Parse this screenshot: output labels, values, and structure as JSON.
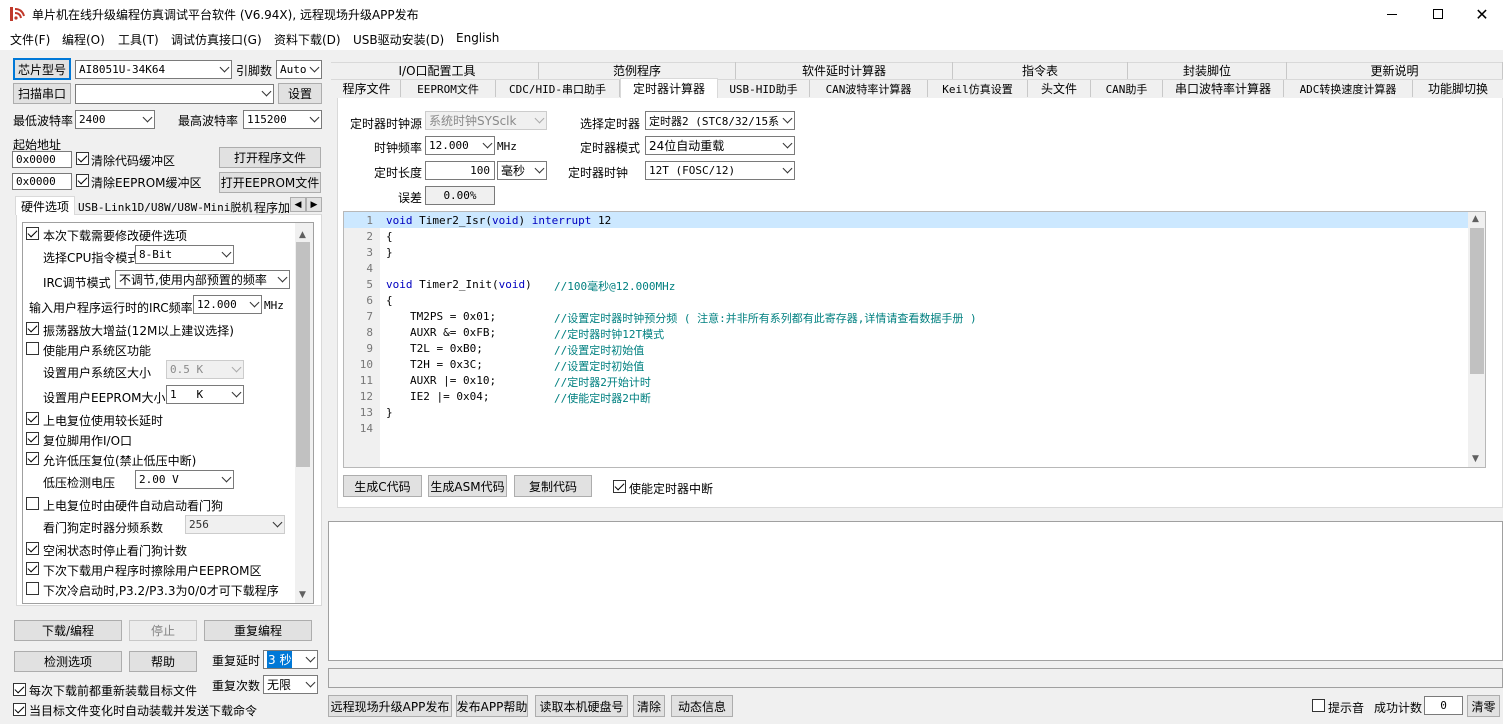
{
  "window": {
    "title": "单片机在线升级编程仿真调试平台软件 (V6.94X), 远程现场升级APP发布"
  },
  "menu": [
    "文件(F)",
    "编程(O)",
    "工具(T)",
    "调试仿真接口(G)",
    "资料下载(D)",
    "USB驱动安装(D)",
    "English"
  ],
  "left": {
    "chip_btn": "芯片型号",
    "chip_value": "AI8051U-34K64",
    "pin_label": "引脚数",
    "pin_value": "Auto",
    "scan_btn": "扫描串口",
    "port_value": "",
    "settings_btn": "设置",
    "min_baud_label": "最低波特率",
    "min_baud_value": "2400",
    "max_baud_label": "最高波特率",
    "max_baud_value": "115200",
    "start_addr_label": "起始地址",
    "addr1": "0x0000",
    "clear_code": "清除代码缓冲区",
    "open_prog_btn": "打开程序文件",
    "addr2": "0x0000",
    "clear_eeprom": "清除EEPROM缓冲区",
    "open_eeprom_btn": "打开EEPROM文件",
    "tabs": [
      "硬件选项",
      "USB-Link1D/U8W/U8W-Mini脱机",
      "程序加"
    ],
    "hw": {
      "need_modify": "本次下载需要修改硬件选项",
      "cpu_label": "选择CPU指令模式",
      "cpu_value": "8-Bit",
      "irc_label": "IRC调节模式",
      "irc_value": "不调节,使用内部预置的频率",
      "irc_freq_label": "输入用户程序运行时的IRC频率",
      "irc_freq_value": "12.000",
      "irc_freq_unit": "MHz",
      "osc_gain": "振荡器放大增益(12M以上建议选择)",
      "enable_sys": "使能用户系统区功能",
      "sys_size_label": "设置用户系统区大小",
      "sys_size_value": "0.5 K",
      "eeprom_size_label": "设置用户EEPROM大小",
      "eeprom_size_value": "1   K",
      "long_delay": "上电复位使用较长延时",
      "reset_io": "复位脚用作I/O口",
      "low_volt_reset": "允许低压复位(禁止低压中断)",
      "low_volt_label": "低压检测电压",
      "low_volt_value": "2.00 V",
      "watchdog": "上电复位时由硬件自动启动看门狗",
      "wdt_div_label": "看门狗定时器分频系数",
      "wdt_div_value": "256",
      "idle_stop": "空闲状态时停止看门狗计数",
      "erase_eeprom": "下次下载用户程序时擦除用户EEPROM区",
      "cold_start": "下次冷启动时,P3.2/P3.3为0/0才可下载程序"
    },
    "download_btn": "下载/编程",
    "stop_btn": "停止",
    "reprog_btn": "重复编程",
    "check_btn": "检测选项",
    "help_btn": "帮助",
    "repeat_delay_label": "重复延时",
    "repeat_delay_value": "3 秒",
    "repeat_count_label": "重复次数",
    "repeat_count_value": "无限",
    "reload_each": "每次下载前都重新装载目标文件",
    "auto_load": "当目标文件变化时自动装载并发送下载命令"
  },
  "tabs_row1": [
    "I/O口配置工具",
    "范例程序",
    "软件延时计算器",
    "指令表",
    "封装脚位",
    "更新说明"
  ],
  "tabs_row2": [
    "程序文件",
    "EEPROM文件",
    "CDC/HID-串口助手",
    "定时器计算器",
    "USB-HID助手",
    "CAN波特率计算器",
    "Keil仿真设置",
    "头文件",
    "CAN助手",
    "串口波特率计算器",
    "ADC转换速度计算器",
    "功能脚切换"
  ],
  "timer": {
    "clock_src_label": "定时器时钟源",
    "clock_src_value": "系统时钟SYSclk",
    "select_timer_label": "选择定时器",
    "select_timer_value": "定时器2 (STC8/32/15系",
    "freq_label": "时钟频率",
    "freq_value": "12.000",
    "freq_unit": "MHz",
    "mode_label": "定时器模式",
    "mode_value": "24位自动重载",
    "length_label": "定时长度",
    "length_value": "100",
    "length_unit": "毫秒",
    "timer_clock_label": "定时器时钟",
    "timer_clock_value": "12T (FOSC/12)",
    "error_label": "误差",
    "error_value": "0.00%",
    "gen_c_btn": "生成C代码",
    "gen_asm_btn": "生成ASM代码",
    "copy_btn": "复制代码",
    "enable_int": "使能定时器中断"
  },
  "code": {
    "line_numbers": [
      "1",
      "2",
      "3",
      "4",
      "5",
      "6",
      "7",
      "8",
      "9",
      "10",
      "11",
      "12",
      "13",
      "14"
    ],
    "l1_kw1": "void",
    "l1_t1": " Timer2_Isr(",
    "l1_kw2": "void",
    "l1_t2": ") ",
    "l1_kw3": "interrupt",
    "l1_t3": " 12",
    "l2": "{",
    "l3": "}",
    "l5_kw": "void",
    "l5_t": " Timer2_Init(",
    "l5_kw2": "void",
    "l5_t2": ")",
    "l5_cm": "//100毫秒@12.000MHz",
    "l6": "{",
    "l7_t": "TM2PS = 0x01;",
    "l7_cm": "//设置定时器时钟预分频 ( 注意:并非所有系列都有此寄存器,详情请查看数据手册 )",
    "l8_t": "AUXR &= 0xFB;",
    "l8_cm": "//定时器时钟12T模式",
    "l9_t": "T2L = 0xB0;",
    "l9_cm": "//设置定时初始值",
    "l10_t": "T2H = 0x3C;",
    "l10_cm": "//设置定时初始值",
    "l11_t": "AUXR |= 0x10;",
    "l11_cm": "//定时器2开始计时",
    "l12_t": "IE2 |= 0x04;",
    "l12_cm": "//使能定时器2中断",
    "l13": "}"
  },
  "bottom": {
    "remote_btn": "远程现场升级APP发布",
    "publish_help_btn": "发布APP帮助",
    "read_disk_btn": "读取本机硬盘号",
    "clear_btn": "清除",
    "dynamic_btn": "动态信息",
    "sound_label": "提示音",
    "success_label": "成功计数",
    "success_value": "0",
    "zero_btn": "清零"
  },
  "colors": {
    "accent": "#0078d7",
    "code_highlight": "#cce8ff",
    "keyword": "#0000c0",
    "comment": "#008080"
  }
}
